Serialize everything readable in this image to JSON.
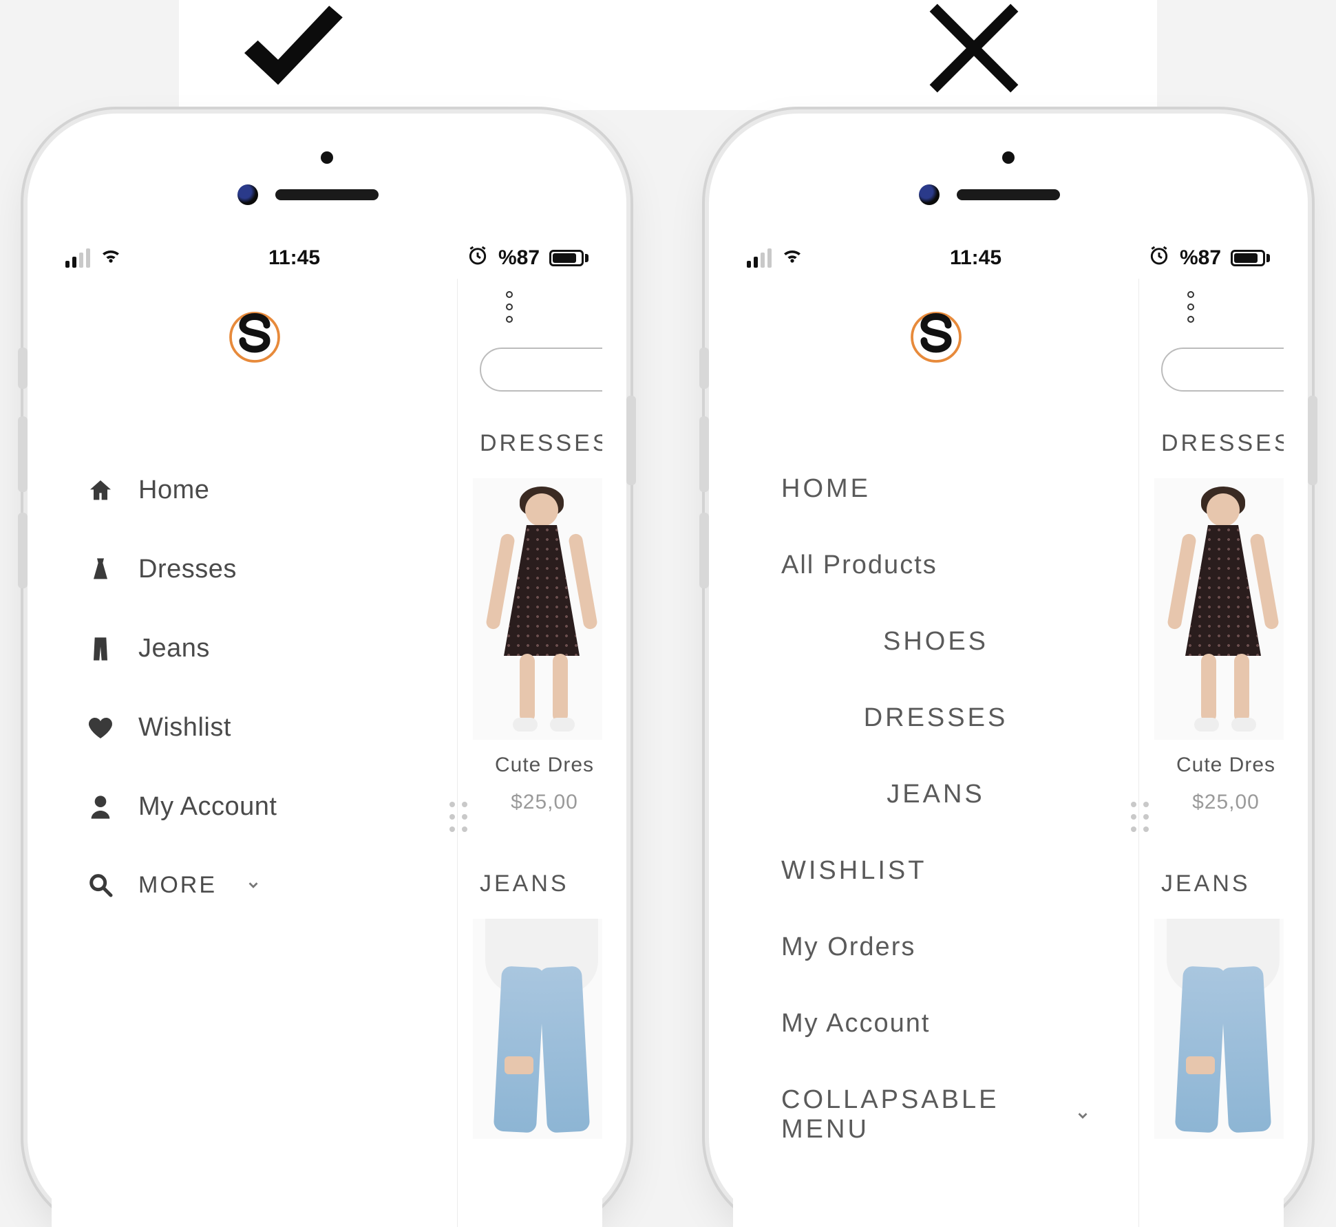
{
  "marks": {
    "good": "check",
    "bad": "cross"
  },
  "status": {
    "time": "11:45",
    "battery_text": "%87"
  },
  "content": {
    "section_dresses": "DRESSES",
    "section_jeans": "JEANS",
    "product_dress": {
      "name": "Cute Dres",
      "price": "$25,00"
    }
  },
  "good_menu": {
    "items": [
      {
        "key": "home",
        "label": "Home",
        "icon": "home-icon"
      },
      {
        "key": "dresses",
        "label": "Dresses",
        "icon": "dress-icon"
      },
      {
        "key": "jeans",
        "label": "Jeans",
        "icon": "jeans-icon"
      },
      {
        "key": "wishlist",
        "label": "Wishlist",
        "icon": "heart-icon"
      },
      {
        "key": "account",
        "label": "My Account",
        "icon": "user-icon"
      }
    ],
    "more_label": "MORE"
  },
  "bad_menu": {
    "items": [
      {
        "label": "HOME",
        "style": "upper"
      },
      {
        "label": "All Products",
        "style": ""
      },
      {
        "label": "SHOES",
        "style": "upper center"
      },
      {
        "label": "DRESSES",
        "style": "upper center"
      },
      {
        "label": "JEANS",
        "style": "upper center"
      },
      {
        "label": "WISHLIST",
        "style": "upper"
      },
      {
        "label": "My Orders",
        "style": ""
      },
      {
        "label": "My Account",
        "style": ""
      }
    ],
    "collapsable_label": "COLLAPSABLE MENU"
  }
}
